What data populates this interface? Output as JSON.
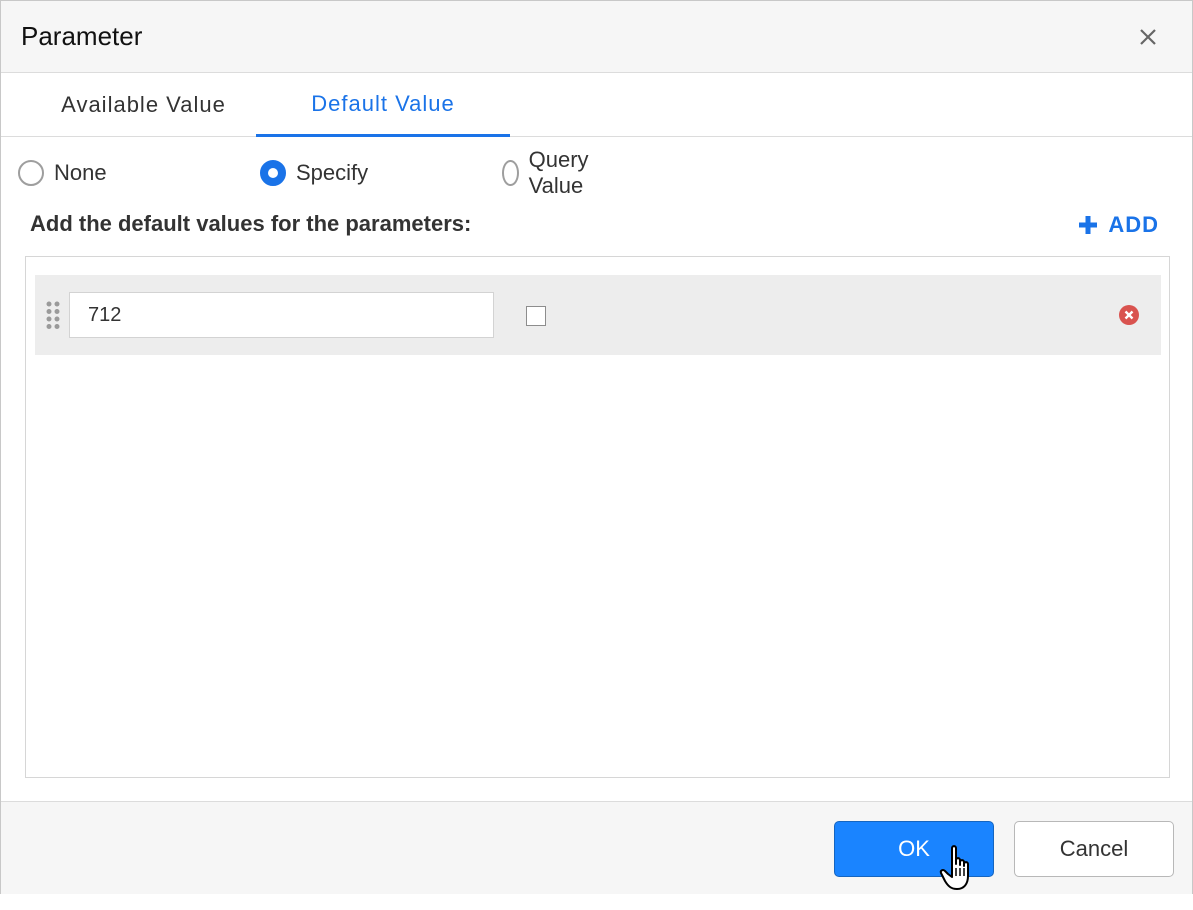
{
  "dialog": {
    "title": "Parameter",
    "close_icon": "close-icon"
  },
  "tabs": [
    {
      "label": "Available Value",
      "active": false
    },
    {
      "label": "Default Value",
      "active": true
    }
  ],
  "radio_options": [
    {
      "label": "None",
      "checked": false
    },
    {
      "label": "Specify",
      "checked": true
    },
    {
      "label": "Query Value",
      "checked": false
    }
  ],
  "section": {
    "label": "Add the default values for the parameters:",
    "add_label": "ADD",
    "add_icon": "plus-icon"
  },
  "values": [
    {
      "value": "712",
      "checked": false,
      "drag_icon": "drag-handle-icon",
      "delete_icon": "delete-icon"
    }
  ],
  "footer": {
    "ok_label": "OK",
    "cancel_label": "Cancel"
  },
  "colors": {
    "accent": "#1a73e8",
    "ok_button": "#1a84ff",
    "delete": "#d9534f",
    "row_bg": "#ededed"
  }
}
